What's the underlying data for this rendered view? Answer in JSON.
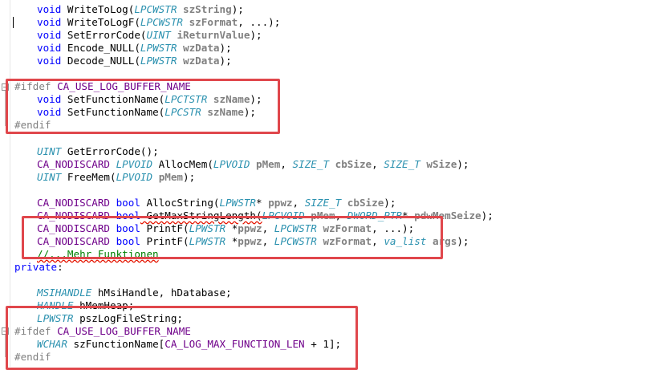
{
  "code_lines": [
    {
      "indent": true,
      "tokens": [
        [
          "kw",
          "void"
        ],
        [
          "fn",
          " WriteToLog("
        ],
        [
          "ty",
          "LPCWSTR"
        ],
        [
          "fn",
          " "
        ],
        [
          "pr",
          "szString"
        ],
        [
          "fn",
          ");"
        ]
      ]
    },
    {
      "indent": true,
      "tokens": [
        [
          "kw",
          "void"
        ],
        [
          "fn",
          " WriteToLogF("
        ],
        [
          "ty",
          "LPCWSTR"
        ],
        [
          "fn",
          " "
        ],
        [
          "pr",
          "szFormat"
        ],
        [
          "fn",
          ", ...);"
        ]
      ]
    },
    {
      "indent": true,
      "tokens": [
        [
          "kw",
          "void"
        ],
        [
          "fn",
          " SetErrorCode("
        ],
        [
          "ty",
          "UINT"
        ],
        [
          "fn",
          " "
        ],
        [
          "pr",
          "iReturnValue"
        ],
        [
          "fn",
          ");"
        ]
      ]
    },
    {
      "indent": true,
      "tokens": [
        [
          "kw",
          "void"
        ],
        [
          "fn",
          " Encode_NULL("
        ],
        [
          "ty",
          "LPWSTR"
        ],
        [
          "fn",
          " "
        ],
        [
          "pr",
          "wzData"
        ],
        [
          "fn",
          ");"
        ]
      ]
    },
    {
      "indent": true,
      "tokens": [
        [
          "kw",
          "void"
        ],
        [
          "fn",
          " Decode_NULL("
        ],
        [
          "ty",
          "LPWSTR"
        ],
        [
          "fn",
          " "
        ],
        [
          "pr",
          "wzData"
        ],
        [
          "fn",
          ");"
        ]
      ]
    },
    {
      "indent": false,
      "tokens": []
    },
    {
      "indent": false,
      "tokens": [
        [
          "pp",
          "#ifdef "
        ],
        [
          "mac",
          "CA_USE_LOG_BUFFER_NAME"
        ]
      ]
    },
    {
      "indent": true,
      "tokens": [
        [
          "kw",
          "void"
        ],
        [
          "fn",
          " SetFunctionName("
        ],
        [
          "ty",
          "LPCTSTR"
        ],
        [
          "fn",
          " "
        ],
        [
          "pr",
          "szName"
        ],
        [
          "fn",
          ");"
        ]
      ]
    },
    {
      "indent": true,
      "tokens": [
        [
          "kw",
          "void"
        ],
        [
          "fn",
          " SetFunctionName("
        ],
        [
          "ty",
          "LPCSTR"
        ],
        [
          "fn",
          " "
        ],
        [
          "pr",
          "szName"
        ],
        [
          "fn",
          ");"
        ]
      ]
    },
    {
      "indent": false,
      "tokens": [
        [
          "pp",
          "#endif"
        ]
      ]
    },
    {
      "indent": false,
      "tokens": []
    },
    {
      "indent": true,
      "tokens": [
        [
          "ty",
          "UINT"
        ],
        [
          "fn",
          " GetErrorCode();"
        ]
      ]
    },
    {
      "indent": true,
      "tokens": [
        [
          "mac",
          "CA_NODISCARD"
        ],
        [
          "fn",
          " "
        ],
        [
          "ty",
          "LPVOID"
        ],
        [
          "fn",
          " AllocMem("
        ],
        [
          "ty",
          "LPVOID"
        ],
        [
          "fn",
          " "
        ],
        [
          "pr",
          "pMem"
        ],
        [
          "fn",
          ", "
        ],
        [
          "ty",
          "SIZE_T"
        ],
        [
          "fn",
          " "
        ],
        [
          "pr",
          "cbSize"
        ],
        [
          "fn",
          ", "
        ],
        [
          "ty",
          "SIZE_T"
        ],
        [
          "fn",
          " "
        ],
        [
          "pr",
          "wSize"
        ],
        [
          "fn",
          ");"
        ]
      ]
    },
    {
      "indent": true,
      "tokens": [
        [
          "ty",
          "UINT"
        ],
        [
          "fn",
          " FreeMem("
        ],
        [
          "ty",
          "LPVOID"
        ],
        [
          "fn",
          " "
        ],
        [
          "pr",
          "pMem"
        ],
        [
          "fn",
          ");"
        ]
      ]
    },
    {
      "indent": false,
      "tokens": []
    },
    {
      "indent": true,
      "tokens": [
        [
          "mac",
          "CA_NODISCARD"
        ],
        [
          "fn",
          " "
        ],
        [
          "kw",
          "bool"
        ],
        [
          "fn",
          " AllocString("
        ],
        [
          "ty",
          "LPWSTR"
        ],
        [
          "fn",
          "* "
        ],
        [
          "pr",
          "ppwz"
        ],
        [
          "fn",
          ", "
        ],
        [
          "ty",
          "SIZE_T"
        ],
        [
          "fn",
          " "
        ],
        [
          "pr",
          "cbSize"
        ],
        [
          "fn",
          ");"
        ]
      ]
    },
    {
      "indent": true,
      "tokens": [
        [
          "mac",
          "CA_NODISCARD"
        ],
        [
          "fn",
          " "
        ],
        [
          "kw",
          "bool"
        ],
        [
          "fn",
          " GetMaxStringLength("
        ],
        [
          "ty",
          "LPCVOID"
        ],
        [
          "fn",
          " "
        ],
        [
          "pr",
          "pMem"
        ],
        [
          "fn",
          ", "
        ],
        [
          "ty",
          "DWORD_PTR"
        ],
        [
          "fn",
          "* "
        ],
        [
          "pr",
          "pdwMemSeize"
        ],
        [
          "fn",
          ");"
        ]
      ]
    },
    {
      "indent": true,
      "tokens": [
        [
          "mac",
          "CA_NODISCARD"
        ],
        [
          "fn",
          " "
        ],
        [
          "kw",
          "bool"
        ],
        [
          "fn",
          " PrintF("
        ],
        [
          "ty",
          "LPWSTR"
        ],
        [
          "fn",
          " *"
        ],
        [
          "pr",
          "ppwz"
        ],
        [
          "fn",
          ", "
        ],
        [
          "ty",
          "LPCWSTR"
        ],
        [
          "fn",
          " "
        ],
        [
          "pr",
          "wzFormat"
        ],
        [
          "fn",
          ", ...);"
        ]
      ]
    },
    {
      "indent": true,
      "tokens": [
        [
          "mac",
          "CA_NODISCARD"
        ],
        [
          "fn",
          " "
        ],
        [
          "kw",
          "bool"
        ],
        [
          "fn",
          " PrintF("
        ],
        [
          "ty",
          "LPWSTR"
        ],
        [
          "fn",
          " *"
        ],
        [
          "pr",
          "ppwz"
        ],
        [
          "fn",
          ", "
        ],
        [
          "ty",
          "LPCWSTR"
        ],
        [
          "fn",
          " "
        ],
        [
          "pr",
          "wzFormat"
        ],
        [
          "fn",
          ", "
        ],
        [
          "ty",
          "va_list"
        ],
        [
          "fn",
          " "
        ],
        [
          "pr",
          "args"
        ],
        [
          "fn",
          ");"
        ]
      ]
    },
    {
      "indent": true,
      "tokens": [
        [
          "cm",
          "//...Mehr Funktionen"
        ]
      ]
    },
    {
      "indent": false,
      "tokens": [
        [
          "kw",
          "private"
        ],
        [
          "fn",
          ":"
        ]
      ]
    },
    {
      "indent": false,
      "tokens": []
    },
    {
      "indent": true,
      "tokens": [
        [
          "ty",
          "MSIHANDLE"
        ],
        [
          "fn",
          " hMsiHandle, hDatabase;"
        ]
      ]
    },
    {
      "indent": true,
      "tokens": [
        [
          "ty",
          "HANDLE"
        ],
        [
          "fn",
          " hMemHeap;"
        ]
      ]
    },
    {
      "indent": true,
      "tokens": [
        [
          "ty",
          "LPWSTR"
        ],
        [
          "fn",
          " pszLogFileString;"
        ]
      ]
    },
    {
      "indent": false,
      "tokens": [
        [
          "pp",
          "#ifdef "
        ],
        [
          "mac",
          "CA_USE_LOG_BUFFER_NAME"
        ]
      ]
    },
    {
      "indent": true,
      "tokens": [
        [
          "ty",
          "WCHAR"
        ],
        [
          "fn",
          " szFunctionName["
        ],
        [
          "mac",
          "CA_LOG_MAX_FUNCTION_LEN"
        ],
        [
          "fn",
          " + 1];"
        ]
      ]
    },
    {
      "indent": false,
      "tokens": [
        [
          "pp",
          "#endif"
        ]
      ]
    }
  ],
  "colors": {
    "highlight_border": "#e0474c",
    "keyword": "#0000ff",
    "type": "#2b91af",
    "macro": "#6f008a",
    "preprocessor": "#808080",
    "comment": "#008000"
  }
}
